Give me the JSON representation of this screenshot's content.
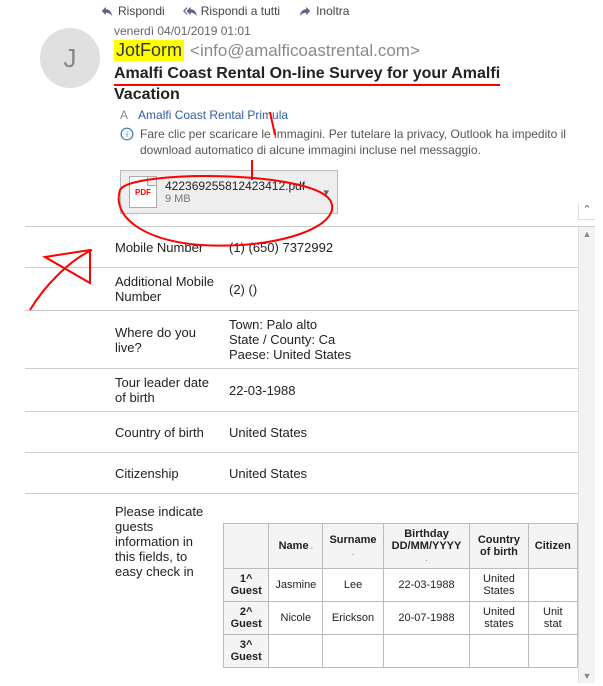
{
  "toolbar": {
    "reply": "Rispondi",
    "replyAll": "Rispondi a tutti",
    "forward": "Inoltra"
  },
  "header": {
    "date": "venerdì 04/01/2019 01:01",
    "senderName": "JotForm",
    "senderEmail": "<info@amalficoastrental.com>",
    "avatarInitial": "J",
    "subject1": "Amalfi Coast Rental On-line Survey for your Amalfi",
    "subject2": "Vacation",
    "toLabel": "A",
    "toName": "Amalfi Coast Rental Primula",
    "infoText": "Fare clic per scaricare le immagini. Per tutelare la privacy, Outlook ha impedito il download automatico di alcune immagini incluse nel messaggio."
  },
  "attachment": {
    "icon": "PDF",
    "name": "42236925581​24234​12.pdf",
    "size": "9 MB"
  },
  "fields": {
    "mobileNumber": {
      "label": "Mobile Number",
      "value": "(1) (650) 7372992"
    },
    "addMobile": {
      "label": "Additional Mobile Number",
      "value": "(2) ()"
    },
    "whereLive": {
      "label": "Where do you live?",
      "value": "Town: Palo alto\nState / County: Ca\nPaese: United States"
    },
    "leaderDob": {
      "label": "Tour leader date of birth",
      "value": "22-03-1988"
    },
    "countryBirth": {
      "label": "Country of birth",
      "value": "United States"
    },
    "citizenship": {
      "label": "Citizenship",
      "value": "United States"
    },
    "guestsLabel": "Please indicate guests information in this fields, to easy check in"
  },
  "guestTable": {
    "headers": {
      "name": "Name",
      "surname": "Surname",
      "birthday": "Birthday DD/MM/YYYY",
      "countryBirth": "Country of birth",
      "citizenship": "Citizen"
    },
    "rows": [
      {
        "rh": "1^ Guest",
        "name": "Jasmine",
        "surname": "Lee",
        "birthday": "22-03-1988",
        "country": "United States",
        "citizen": ""
      },
      {
        "rh": "2^ Guest",
        "name": "Nicole",
        "surname": "Erickson",
        "birthday": "20-07-1988",
        "country": "United states",
        "citizen": "Unit stat"
      },
      {
        "rh": "3^ Guest",
        "name": "",
        "surname": "",
        "birthday": "",
        "country": "",
        "citizen": ""
      }
    ]
  }
}
